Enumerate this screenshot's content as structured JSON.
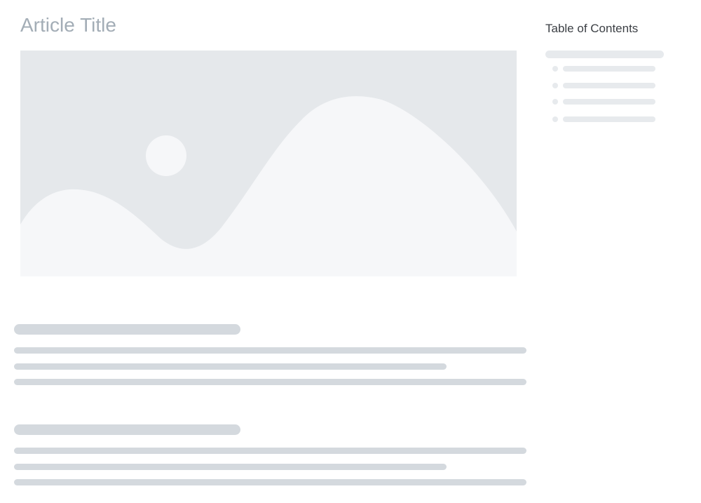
{
  "article": {
    "title": "Article Title"
  },
  "hero_image": {
    "icon": "image-placeholder-icon",
    "background_color": "#e5e8eb",
    "shape_color": "#f6f7f9"
  },
  "content_skeleton": {
    "sections": 2,
    "lines_per_section": 3,
    "skeleton_color": "#d4d9de"
  },
  "toc": {
    "title": "Table of Contents",
    "item_count": 4,
    "skeleton_color": "#e7eaed"
  }
}
